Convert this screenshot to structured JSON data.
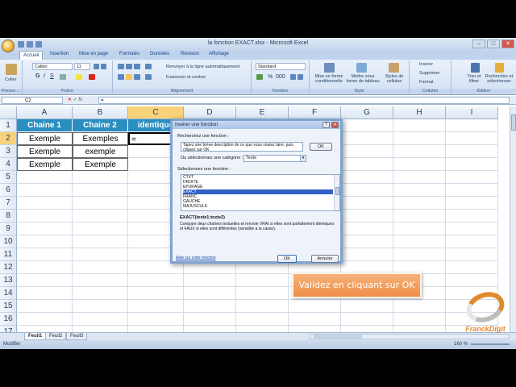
{
  "window": {
    "title": "la fonction EXACT.xlsx - Microsoft Excel",
    "controls": [
      "–",
      "□",
      "✕"
    ]
  },
  "ribbon_tabs": [
    "Accueil",
    "Insertion",
    "Mise en page",
    "Formules",
    "Données",
    "Révision",
    "Affichage"
  ],
  "ribbon": {
    "paste": "Coller",
    "clipboard": "Presse-...",
    "font_name": "Calibri",
    "font_size": "11",
    "font_group": "Police",
    "wrap": "Renvoyer à la ligne automatiquement",
    "merge": "Fusionner et centrer",
    "align_group": "Alignement",
    "number_format": "Standard",
    "number_group": "Nombre",
    "cond_format": "Mise en forme conditionnelle",
    "table_format": "Mettre sous forme de tableau",
    "cell_styles": "Styles de cellules",
    "style_group": "Style",
    "insert": "Insérer",
    "delete": "Supprimer",
    "format": "Format",
    "cells_group": "Cellules",
    "sort": "Trier et filtrer",
    "find": "Rechercher et sélectionner",
    "edit_group": "Édition"
  },
  "formula_bar": {
    "name_box": "C2",
    "fx": "fx",
    "value": "="
  },
  "columns": [
    "A",
    "B",
    "C",
    "D",
    "E",
    "F",
    "G",
    "H",
    "I"
  ],
  "selected_column": "C",
  "rows": [
    "1",
    "2",
    "3",
    "4",
    "5",
    "6",
    "7",
    "8",
    "9",
    "10",
    "11",
    "12",
    "13",
    "14",
    "15",
    "16",
    "17"
  ],
  "selected_row": "2",
  "cells": {
    "A1": "Chaine 1",
    "B1": "Chaine 2",
    "C1": "identique",
    "A2": "Exemple",
    "B2": "Exemples",
    "C2": "=",
    "A3": "Exemple",
    "B3": "exemple",
    "A4": "Exemple",
    "B4": "Exemple"
  },
  "sheets": [
    "Feuil1",
    "Feuil2",
    "Feuil3"
  ],
  "active_sheet": "Feuil1",
  "status": {
    "mode": "Modifier",
    "zoom": "160 %"
  },
  "dialog": {
    "title": "Insérer une fonction",
    "search_label": "Recherchez une fonction :",
    "search_text": "Tapez une brève description de ce que vous voulez faire, puis cliquez sur OK",
    "search_button": "OK",
    "category_label": "Ou sélectionnez une catégorie :",
    "category": "Texte",
    "function_label": "Sélectionnez une fonction :",
    "functions": [
      "CTXT",
      "DROITE",
      "EPURAGE",
      "EXACT",
      "FRANC",
      "GAUCHE",
      "MAJUSCULE"
    ],
    "selected_function": "EXACT",
    "syntax": "EXACT(texte1;texte2)",
    "description": "Compare deux chaînes textuelles et renvoie VRAI si elles sont parfaitement identiques et FAUX si elles sont différentes (sensible à la casse).",
    "help_link": "Aide sur cette fonction",
    "ok": "OK",
    "cancel": "Annuler"
  },
  "callout": "Validez en cliquant sur OK",
  "brand": "FranckDigit"
}
